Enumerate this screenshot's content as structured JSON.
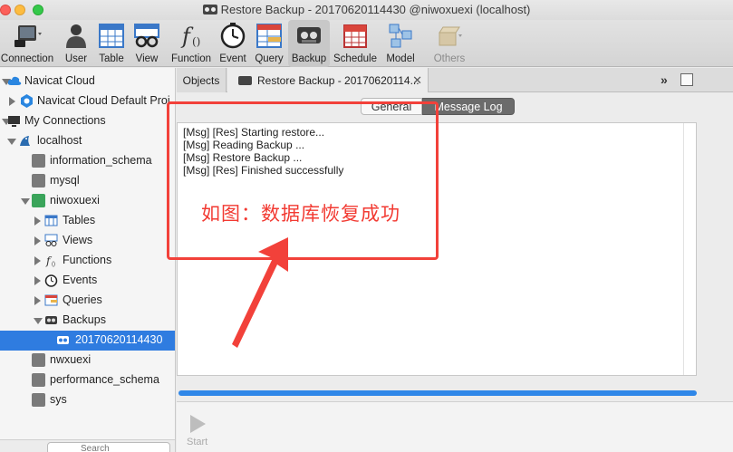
{
  "window": {
    "title": "Restore Backup - 20170620114430 @niwoxuexi (localhost)"
  },
  "toolbar": {
    "items": [
      {
        "label": "Connection",
        "icon": "connection-icon"
      },
      {
        "label": "User",
        "icon": "user-icon"
      },
      {
        "label": "Table",
        "icon": "table-icon"
      },
      {
        "label": "View",
        "icon": "view-icon"
      },
      {
        "label": "Function",
        "icon": "function-icon"
      },
      {
        "label": "Event",
        "icon": "event-icon"
      },
      {
        "label": "Query",
        "icon": "query-icon"
      },
      {
        "label": "Backup",
        "icon": "backup-icon",
        "active": true
      },
      {
        "label": "Schedule",
        "icon": "schedule-icon"
      },
      {
        "label": "Model",
        "icon": "model-icon"
      },
      {
        "label": "Others",
        "icon": "others-icon",
        "disabled": true
      }
    ]
  },
  "sidebar": {
    "items": [
      {
        "label": "Navicat Cloud",
        "icon": "cloud-icon"
      },
      {
        "label": "Navicat Cloud Default Proj",
        "icon": "project-icon"
      },
      {
        "label": "My Connections",
        "icon": "monitor-icon"
      },
      {
        "label": "localhost",
        "icon": "server-icon"
      },
      {
        "label": "information_schema",
        "icon": "database-icon"
      },
      {
        "label": "mysql",
        "icon": "database-icon"
      },
      {
        "label": "niwoxuexi",
        "icon": "database-icon"
      },
      {
        "label": "Tables",
        "icon": "tables-icon"
      },
      {
        "label": "Views",
        "icon": "views-icon"
      },
      {
        "label": "Functions",
        "icon": "functions-icon"
      },
      {
        "label": "Events",
        "icon": "events-icon"
      },
      {
        "label": "Queries",
        "icon": "queries-icon"
      },
      {
        "label": "Backups",
        "icon": "backups-icon"
      },
      {
        "label": "20170620114430",
        "icon": "backup-file-icon",
        "selected": true
      },
      {
        "label": "nwxuexi",
        "icon": "database-icon"
      },
      {
        "label": "performance_schema",
        "icon": "database-icon"
      },
      {
        "label": "sys",
        "icon": "database-icon"
      }
    ],
    "search_placeholder": "Search"
  },
  "tabs": {
    "objects": "Objects",
    "restore": "Restore Backup - 20170620114...",
    "close": "✕",
    "more": "»"
  },
  "content": {
    "segments": {
      "general": "General",
      "message_log": "Message Log"
    },
    "log_lines": [
      "[Msg] [Res] Starting restore...",
      "[Msg] Reading Backup ...",
      "[Msg] Restore Backup ...",
      "[Msg] [Res] Finished successfully"
    ],
    "progress": 1.0,
    "start_label": "Start"
  },
  "annotation": {
    "text": "如图：数据库恢复成功",
    "color": "#f2413a"
  }
}
